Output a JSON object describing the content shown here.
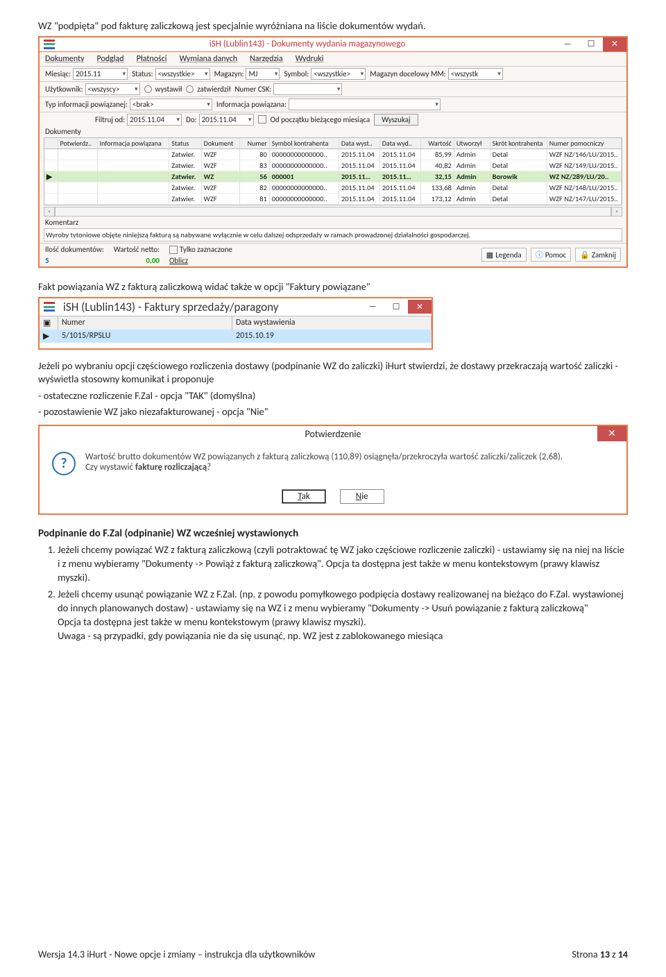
{
  "intro1": "WZ \"podpięta\" pod fakturę zaliczkową jest specjalnie wyróżniana na liście dokumentów wydań.",
  "mainWindow": {
    "title": "iSH (Lublin143) - Dokumenty wydania magazynowego",
    "menu": [
      "Dokumenty",
      "Podgląd",
      "Płatności",
      "Wymiana danych",
      "Narzędzia",
      "Wydruki"
    ],
    "tb1": {
      "okres_l": "Miesiąc:",
      "okres_v": "2015.11",
      "status_l": "Status:",
      "status_v": "<wszystkie>",
      "mag_l": "Magazyn:",
      "mag_v": "MJ",
      "sym_l": "Symbol:",
      "sym_v": "<wszystkie>",
      "magd_l": "Magazyn docelowy MM:",
      "magd_v": "<wszystk"
    },
    "tb2": {
      "user_l": "Użytkownik:",
      "user_v": "<wszyscy>",
      "r1": "wystawił",
      "r2": "zatwierdził",
      "csk_l": "Numer CSK:"
    },
    "tb3": {
      "typ_l": "Typ informacji powiązanej:",
      "typ_v": "<brak>",
      "inf_l": "Informacja powiązana:"
    },
    "tb4": {
      "f_l": "Filtruj od:",
      "f_v": "2015.11.04",
      "d_l": "Do:",
      "d_v": "2015.11.04",
      "chk": "Od początku bieżącego miesiąca",
      "btn": "Wyszukaj"
    },
    "dok_label": "Dokumenty",
    "cols": [
      "",
      "Potwierdz..",
      "Informacja powiązana",
      "Status",
      "Dokument",
      "Numer",
      "Symbol kontrahenta",
      "Data wyst..",
      "Data wyd..",
      "Wartość",
      "Utworzył",
      "Skrót kontrahenta",
      "Numer pomocniczy"
    ],
    "rows": [
      {
        "st": "Zatwier.",
        "dok": "WZF",
        "num": "80",
        "sym": "00000000000000..",
        "dw": "2015.11.04",
        "dy": "2015.11.04",
        "val": "85,99",
        "ut": "Admin",
        "sk": "Detal",
        "np": "WZF NZ/146/LU/2015.."
      },
      {
        "st": "Zatwier.",
        "dok": "WZF",
        "num": "83",
        "sym": "00000000000000..",
        "dw": "2015.11.04",
        "dy": "2015.11.04",
        "val": "40,82",
        "ut": "Admin",
        "sk": "Detal",
        "np": "WZF NZ/149/LU/2015.."
      },
      {
        "sel": true,
        "st": "Zatwier.",
        "dok": "WZ",
        "num": "56",
        "sym": "000001",
        "dw": "2015.11…",
        "dy": "2015.11…",
        "val": "32,15",
        "ut": "Admin",
        "sk": "Borowik",
        "np": "WZ NZ/289/LU/20.."
      },
      {
        "st": "Zatwier.",
        "dok": "WZF",
        "num": "82",
        "sym": "00000000000000..",
        "dw": "2015.11.04",
        "dy": "2015.11.04",
        "val": "133,68",
        "ut": "Admin",
        "sk": "Detal",
        "np": "WZF NZ/148/LU/2015.."
      },
      {
        "st": "Zatwier.",
        "dok": "WZF",
        "num": "81",
        "sym": "00000000000000..",
        "dw": "2015.11.04",
        "dy": "2015.11.04",
        "val": "173,12",
        "ut": "Admin",
        "sk": "Detal",
        "np": "WZF NZ/147/LU/2015.."
      }
    ],
    "kom_l": "Komentarz",
    "kom": "Wyroby tytoniowe objęte niniejszą fakturą są nabywane wyłącznie w celu dalszej odsprzedaży w ramach prowadzonej działalności gospodarczej.",
    "sb": {
      "il_l": "Ilość dokumentów:",
      "il": "5",
      "wn_l": "Wartość netto:",
      "wn": "0,00",
      "tz": "Tylko zaznaczone",
      "ob": "Oblicz",
      "leg": "Legenda",
      "pom": "Pomoc",
      "zam": "Zamknij"
    }
  },
  "para2": "Fakt powiązania WZ z fakturą zaliczkową widać także w opcji \"Faktury powiązane\"",
  "miniWindow": {
    "title": "iSH (Lublin143) - Faktury sprzedaży/paragony",
    "col1": "Numer",
    "col2": "Data wystawienia",
    "v1": "5/1015/RPSLU",
    "v2": "2015.10.19"
  },
  "para3": "Jeżeli po wybraniu opcji częściowego rozliczenia dostawy (podpinanie WZ do zaliczki) iHurt stwierdzi, że dostawy przekraczają wartość zaliczki - wyświetla stosowny komunikat i proponuje",
  "para3b": "- ostateczne rozliczenie F.Zal - opcja \"TAK\" (domyślna)",
  "para3c": "- pozostawienie WZ jako niezafakturowanej - opcja \"Nie\"",
  "dialog": {
    "title": "Potwierdzenie",
    "line1": "Wartość brutto dokumentów WZ powiązanych z fakturą zaliczkową (110,89) osiągnęła/przekroczyła wartość zaliczki/zaliczek (2,68).",
    "line2": "Czy wystawić fakturę rozliczającą?",
    "yes": "Tak",
    "no": "Nie"
  },
  "h4": "Podpinanie do F.Zal (odpinanie) WZ wcześniej wystawionych",
  "li1": "Jeżeli chcemy powiązać WZ z fakturą zaliczkową (czyli potraktować tę WZ jako częściowe rozliczenie zaliczki) - ustawiamy się na niej na liście i z menu wybieramy \"Dokumenty -> Powiąż z fakturą zaliczkową\". Opcja ta dostępna jest także w menu kontekstowym (prawy klawisz myszki).",
  "li2a": "Jeżeli chcemy usunąć powiązanie WZ z F.Zal. (np. z powodu pomyłkowego podpięcia dostawy realizowanej na bieżąco do F.Zal. wystawionej do innych planowanych dostaw) - ustawiamy się  na WZ i z menu wybieramy \"Dokumenty -> Usuń powiązanie z fakturą zaliczkową\"",
  "li2b": "Opcja ta dostępna jest także w menu kontekstowym (prawy klawisz myszki).",
  "li2c": "Uwaga - są przypadki, gdy powiązania nie da się usunąć, np. WZ jest z zablokowanego miesiąca",
  "footer_l": "Wersja 14.3 iHurt - Nowe opcje i zmiany – instrukcja dla użytkowników",
  "footer_r": "Strona 13 z 14"
}
